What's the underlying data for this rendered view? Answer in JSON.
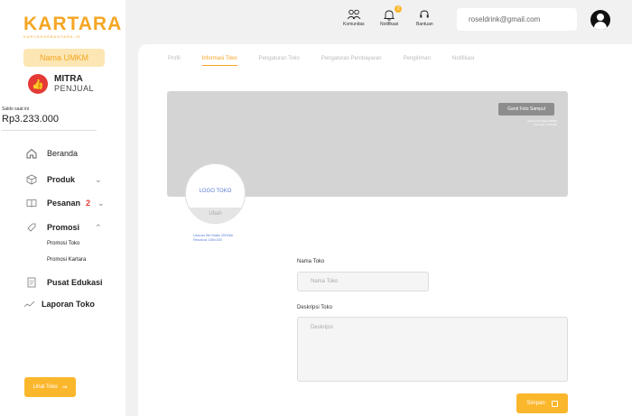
{
  "brand": {
    "name": "KARTARA",
    "tagline": "KARYANGEBANTARA.ID",
    "color": "#f5a623"
  },
  "sidebar": {
    "umkm_label": "Nama UMKM",
    "mitra_title": "MITRA",
    "mitra_subtitle": "PENJUAL",
    "saldo_label": "Saldo saat ini",
    "saldo_value": "Rp3.233.000",
    "items": [
      {
        "label": "Beranda",
        "icon": "home-icon"
      },
      {
        "label": "Produk",
        "icon": "box-icon"
      },
      {
        "label": "Pesanan",
        "icon": "book-icon",
        "badge": "2"
      },
      {
        "label": "Promosi",
        "icon": "tag-icon"
      },
      {
        "label": "Pusat Edukasi",
        "icon": "document-icon"
      },
      {
        "label": "Laporan Toko",
        "icon": "chart-line-icon"
      }
    ],
    "promosi_sub": [
      "Promosi Toko",
      "Promosi Kartara"
    ],
    "view_store_label": "Lihat Toko"
  },
  "topbar": {
    "komunitas": "Komunitas",
    "notifikasi": "Notifikasi",
    "notif_count": "2",
    "bantuan": "Bantuan",
    "email": "roseldrink@gmail.com"
  },
  "tabs": [
    "Profil",
    "Informasi Toko",
    "Pengaturan Toko",
    "Pengaturan Pembayaran",
    "Pengiriman",
    "Notifikasi"
  ],
  "active_tab": "Informasi Toko",
  "cover": {
    "button_label": "Ganti Foto Sampul",
    "hint_line1": "Ukuran file Maks 2000kb",
    "hint_line2": "Resolusi 1440x420"
  },
  "logo": {
    "label": "LOGO TOKO",
    "change_label": "Ubah",
    "hint_line1": "Ukuran file Maks 2000kb",
    "hint_line2": "Resolusi 150x150"
  },
  "form": {
    "name_label": "Nama Toko",
    "name_placeholder": "Nama Toko",
    "desc_label": "Deskripsi Toko",
    "desc_placeholder": "Deskripsi",
    "save_label": "Simpan"
  }
}
